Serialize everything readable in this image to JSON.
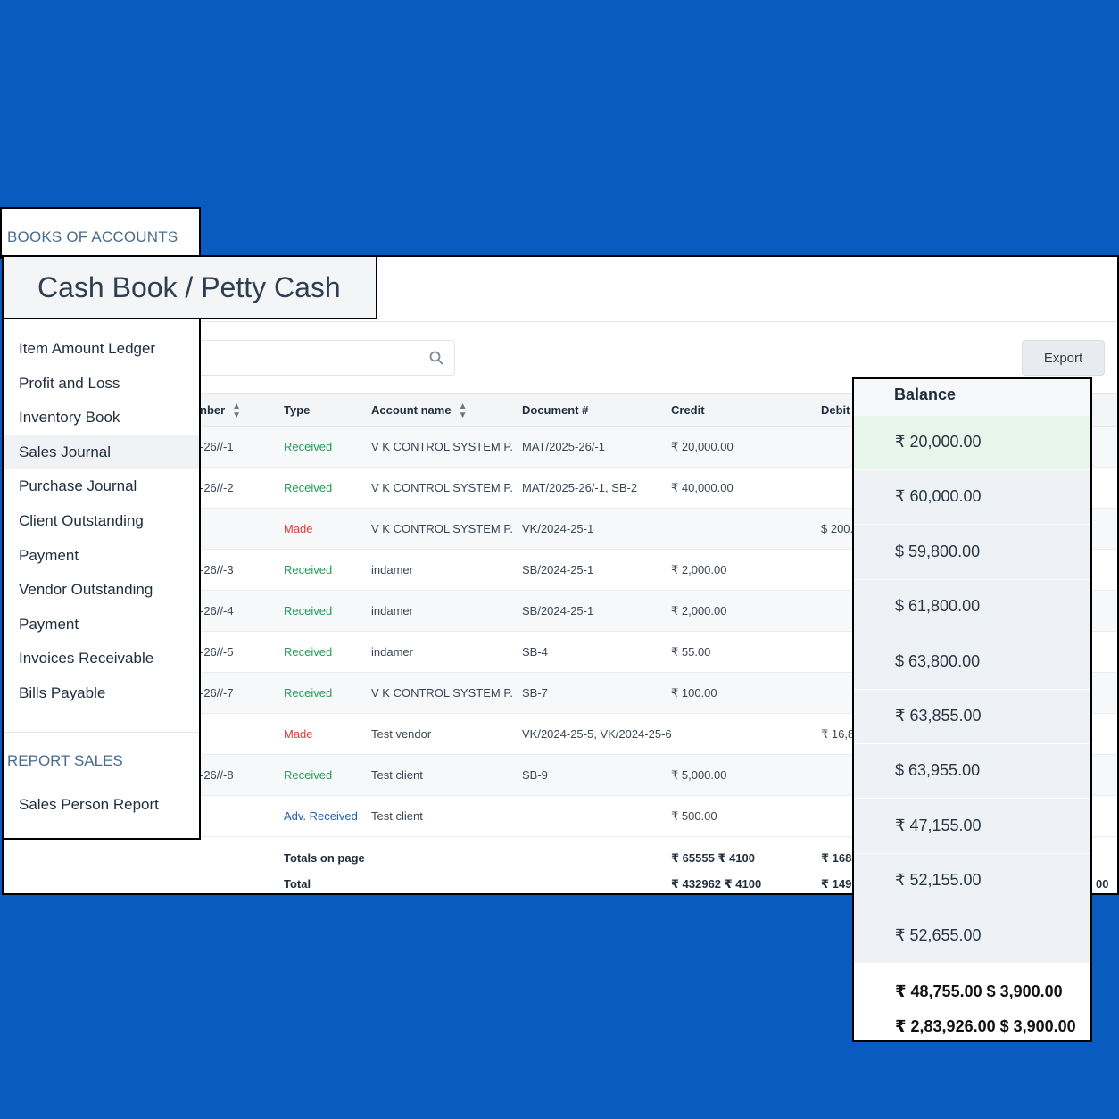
{
  "section_books": "BOOKS OF ACCOUNTS",
  "page_title": "Cash Book / Petty Cash",
  "export_label": "Export",
  "sidebar": {
    "items": [
      {
        "label": "Item Amount Ledger"
      },
      {
        "label": "Profit and Loss"
      },
      {
        "label": "Inventory Book"
      },
      {
        "label": "Sales Journal"
      },
      {
        "label": "Purchase Journal"
      },
      {
        "label": "Client Outstanding"
      },
      {
        "label": "Payment"
      },
      {
        "label": "Vendor Outstanding"
      },
      {
        "label": "Payment"
      },
      {
        "label": "Invoices Receivable"
      },
      {
        "label": "Bills Payable"
      }
    ],
    "report_section": "REPORT SALES",
    "report_item": "Sales Person Report"
  },
  "table": {
    "headers": {
      "number": "nber",
      "type": "Type",
      "account": "Account name",
      "document": "Document #",
      "credit": "Credit",
      "debit": "Debit"
    },
    "rows": [
      {
        "number": "-26//-1",
        "type": "Received",
        "account": "V K CONTROL SYSTEM P...",
        "document": "MAT/2025-26/-1",
        "credit": "₹ 20,000.00",
        "debit": ""
      },
      {
        "number": "-26//-2",
        "type": "Received",
        "account": "V K CONTROL SYSTEM P...",
        "document": "MAT/2025-26/-1, SB-2",
        "credit": "₹ 40,000.00",
        "debit": ""
      },
      {
        "number": "",
        "type": "Made",
        "account": "V K CONTROL SYSTEM P...",
        "document": "VK/2024-25-1",
        "credit": "",
        "debit": "$ 200."
      },
      {
        "number": "-26//-3",
        "type": "Received",
        "account": "indamer",
        "document": "SB/2024-25-1",
        "credit": "₹ 2,000.00",
        "debit": ""
      },
      {
        "number": "-26//-4",
        "type": "Received",
        "account": "indamer",
        "document": "SB/2024-25-1",
        "credit": "₹ 2,000.00",
        "debit": ""
      },
      {
        "number": "-26//-5",
        "type": "Received",
        "account": "indamer",
        "document": "SB-4",
        "credit": "₹ 55.00",
        "debit": ""
      },
      {
        "number": "-26//-7",
        "type": "Received",
        "account": "V K CONTROL SYSTEM P...",
        "document": "SB-7",
        "credit": "₹ 100.00",
        "debit": ""
      },
      {
        "number": "",
        "type": "Made",
        "account": "Test vendor",
        "document": "VK/2024-25-5, VK/2024-25-6",
        "credit": "",
        "debit": "₹ 16,8"
      },
      {
        "number": "-26//-8",
        "type": "Received",
        "account": "Test client",
        "document": "SB-9",
        "credit": "₹ 5,000.00",
        "debit": ""
      },
      {
        "number": "",
        "type": "Adv. Received",
        "account": "Test client",
        "document": "",
        "credit": "₹ 500.00",
        "debit": ""
      }
    ],
    "totals": {
      "page_label": "Totals on page",
      "page_credit": "₹ 65555 ₹ 4100",
      "page_debit": "₹ 168",
      "total_label": "Total",
      "total_credit": "₹ 432962 ₹ 4100",
      "total_debit": "₹ 149",
      "total_tail": "00"
    }
  },
  "balance": {
    "header": "Balance",
    "values": [
      "₹ 20,000.00",
      "₹ 60,000.00",
      "$ 59,800.00",
      "$ 61,800.00",
      "$ 63,800.00",
      "₹ 63,855.00",
      "$ 63,955.00",
      "₹ 47,155.00",
      "₹ 52,155.00",
      "₹ 52,655.00"
    ],
    "page_total": "₹ 48,755.00 $ 3,900.00",
    "grand_total": "₹ 2,83,926.00 $ 3,900.00"
  }
}
